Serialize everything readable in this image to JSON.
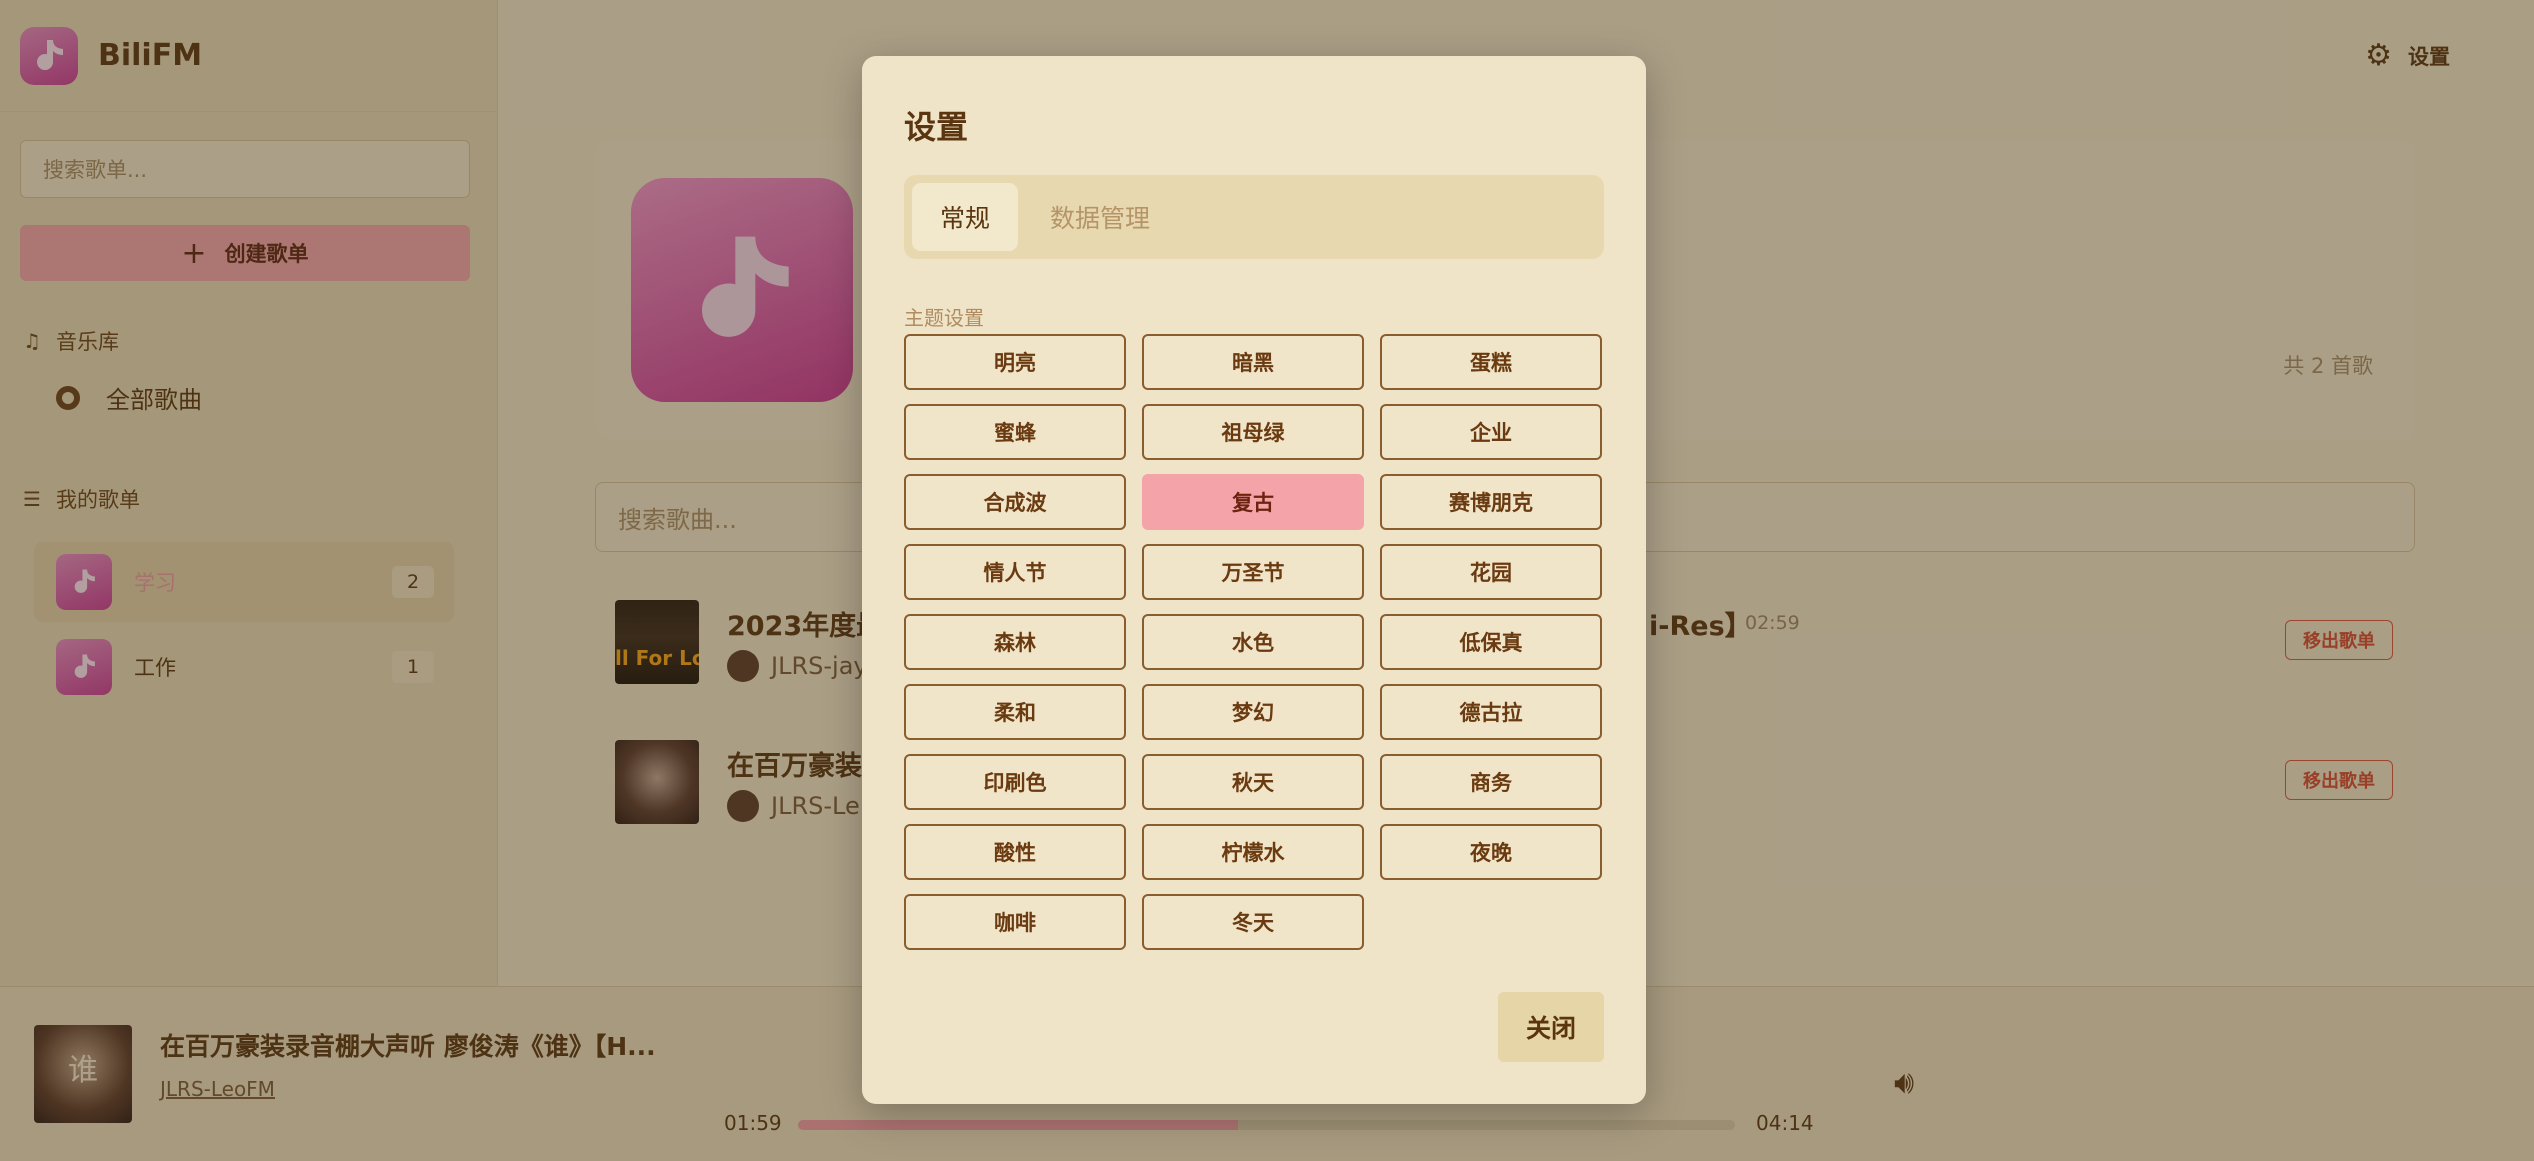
{
  "app": {
    "name": "BiliFM"
  },
  "sidebar": {
    "search_placeholder": "搜索歌单...",
    "create_label": "创建歌单",
    "library_label": "音乐库",
    "all_songs_label": "全部歌曲",
    "my_playlists_label": "我的歌单",
    "playlists": [
      {
        "name": "学习",
        "count": "2",
        "active": true
      },
      {
        "name": "工作",
        "count": "1",
        "active": false
      }
    ]
  },
  "header": {
    "settings_label": "设置",
    "song_total": "共 2 首歌",
    "song_search_placeholder": "搜索歌曲..."
  },
  "songs": [
    {
      "title": "2023年度最",
      "title_tail": "i-Res】",
      "duration": "02:59",
      "artist": "JLRS-jay",
      "cover_text": "ll For Lov",
      "remove_label": "移出歌单"
    },
    {
      "title": "在百万豪装",
      "artist": "JLRS-Le",
      "remove_label": "移出歌单"
    }
  ],
  "player": {
    "title": "在百万豪装录音棚大声听 廖俊涛《谁》【H...",
    "artist": "JLRS-LeoFM",
    "cover_text": "谁",
    "current_time": "01:59",
    "total_time": "04:14",
    "progress": 0.47
  },
  "modal": {
    "title": "设置",
    "tabs": [
      "常规",
      "数据管理"
    ],
    "active_tab": 0,
    "section_label": "主题设置",
    "themes": [
      "明亮",
      "暗黑",
      "蛋糕",
      "蜜蜂",
      "祖母绿",
      "企业",
      "合成波",
      "复古",
      "赛博朋克",
      "情人节",
      "万圣节",
      "花园",
      "森林",
      "水色",
      "低保真",
      "柔和",
      "梦幻",
      "德古拉",
      "印刷色",
      "秋天",
      "商务",
      "酸性",
      "柠檬水",
      "夜晚",
      "咖啡",
      "冬天"
    ],
    "selected_theme": "复古",
    "close_label": "关闭"
  },
  "colors": {
    "accent": "#f4a3a8",
    "text": "#5a3510",
    "panel": "#efe4c8",
    "danger": "#d24a30"
  }
}
